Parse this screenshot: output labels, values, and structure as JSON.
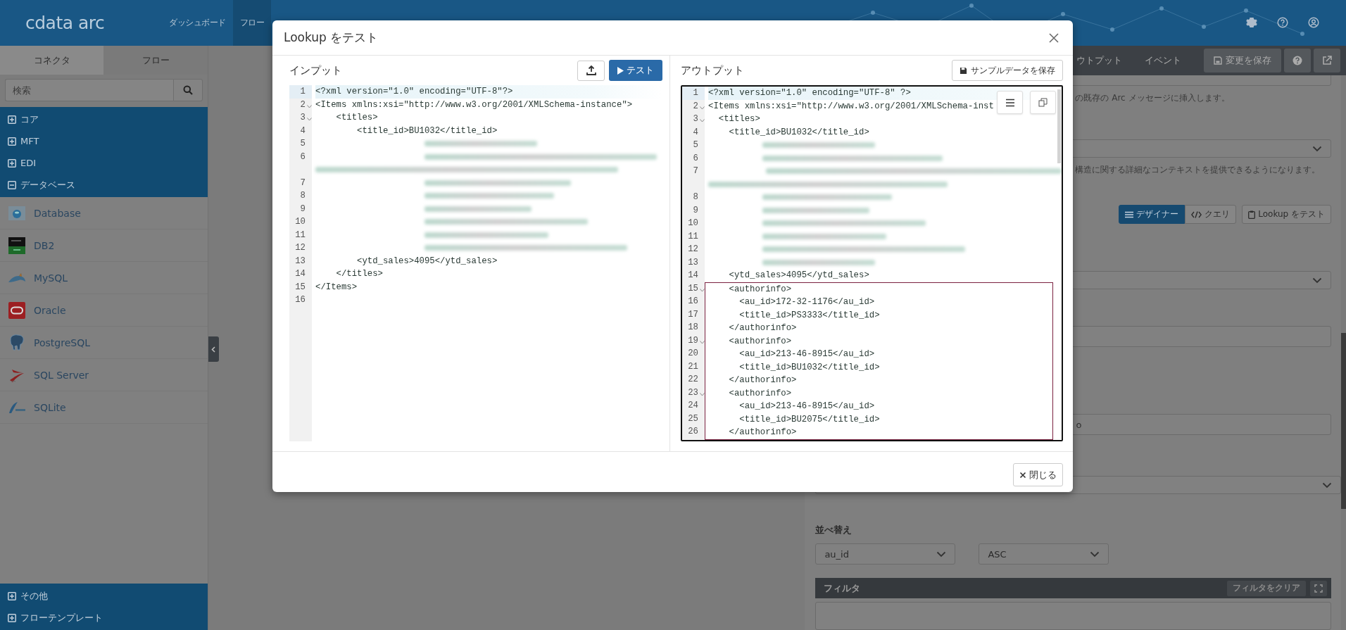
{
  "navbar": {
    "logo": "cdata arc",
    "items": [
      {
        "label": "ダッシュボード",
        "selected": false
      },
      {
        "label": "フロー",
        "selected": true
      }
    ]
  },
  "sidebar": {
    "tabs": [
      {
        "label": "コネクタ",
        "selected": true
      },
      {
        "label": "フロー",
        "selected": false
      }
    ],
    "search": {
      "placeholder": "検索"
    },
    "categories": [
      {
        "label": "コア",
        "expanded": false
      },
      {
        "label": "MFT",
        "expanded": false
      },
      {
        "label": "EDI",
        "expanded": false
      },
      {
        "label": "データベース",
        "expanded": true,
        "children": [
          {
            "label": "Database"
          },
          {
            "label": "DB2"
          },
          {
            "label": "MySQL"
          },
          {
            "label": "Oracle"
          },
          {
            "label": "PostgreSQL"
          },
          {
            "label": "SQL Server"
          },
          {
            "label": "SQLite"
          }
        ]
      }
    ],
    "bottom_categories": [
      {
        "label": "その他",
        "expanded": false
      },
      {
        "label": "フローテンプレート",
        "expanded": false
      }
    ]
  },
  "right_panel": {
    "tabs": [
      {
        "label": "ウトプット",
        "selected": false
      },
      {
        "label": "イベント",
        "selected": false
      }
    ],
    "save_button": "変更を保存",
    "hint_1": "の既存の Arc メッセージに挿入します。",
    "hint_2": "構造に関する詳細なコンテキストを提供できるようになります。",
    "mode_buttons": [
      {
        "label": "デザイナー",
        "selected": true
      },
      {
        "label": "クエリ",
        "selected": false
      }
    ],
    "test_lookup_button": "Lookup をテスト",
    "field_value": "o",
    "sort": {
      "label": "並べ替え",
      "column": "au_id",
      "order": "ASC"
    },
    "filter": {
      "title": "フィルタ",
      "clear_button": "フィルタをクリア"
    }
  },
  "modal": {
    "title": "Lookup をテスト",
    "input": {
      "title": "インプット",
      "test_button": "テスト",
      "lines": [
        {
          "n": "1",
          "kind": "code",
          "text": "<?xml version=\"1.0\" encoding=\"UTF-8\"?>",
          "foldable": false,
          "active": true
        },
        {
          "n": "2",
          "kind": "code",
          "text": "<Items xmlns:xsi=\"http://www.w3.org/2001/XMLSchema-instance\">",
          "foldable": true,
          "active": false
        },
        {
          "n": "3",
          "kind": "code",
          "text": "    <titles>",
          "foldable": true,
          "active": false
        },
        {
          "n": "4",
          "kind": "code",
          "text": "        <title_id>BU1032</title_id>",
          "foldable": false,
          "active": false
        },
        {
          "n": "5",
          "kind": "redacted",
          "foldable": false,
          "active": false
        },
        {
          "n": "6",
          "kind": "redacted_wrapped",
          "foldable": false,
          "active": false
        },
        {
          "n": "7",
          "kind": "redacted",
          "foldable": false,
          "active": false
        },
        {
          "n": "8",
          "kind": "redacted",
          "foldable": false,
          "active": false
        },
        {
          "n": "9",
          "kind": "redacted",
          "foldable": false,
          "active": false
        },
        {
          "n": "10",
          "kind": "redacted",
          "foldable": false,
          "active": false
        },
        {
          "n": "11",
          "kind": "redacted",
          "foldable": false,
          "active": false
        },
        {
          "n": "12",
          "kind": "redacted",
          "foldable": false,
          "active": false
        },
        {
          "n": "13",
          "kind": "code",
          "text": "        <ytd_sales>4095</ytd_sales>",
          "foldable": false,
          "active": false
        },
        {
          "n": "14",
          "kind": "code",
          "text": "    </titles>",
          "foldable": false,
          "active": false
        },
        {
          "n": "15",
          "kind": "code",
          "text": "</Items>",
          "foldable": false,
          "active": false
        },
        {
          "n": "16",
          "kind": "code",
          "foldable": false,
          "active": false
        }
      ]
    },
    "output": {
      "title": "アウトプット",
      "save_button": "サンプルデータを保存",
      "lines": [
        {
          "n": "1",
          "kind": "code",
          "text": "<?xml version=\"1.0\" encoding=\"UTF-8\" ?>",
          "foldable": false,
          "active": true,
          "boxed": false
        },
        {
          "n": "2",
          "kind": "code",
          "text": "<Items xmlns:xsi=\"http://www.w3.org/2001/XMLSchema-inst",
          "foldable": true,
          "active": false,
          "boxed": false
        },
        {
          "n": "3",
          "kind": "code",
          "text": "  <titles>",
          "foldable": true,
          "active": false,
          "boxed": false
        },
        {
          "n": "4",
          "kind": "code",
          "text": "    <title_id>BU1032</title_id>",
          "foldable": false,
          "active": false,
          "boxed": false
        },
        {
          "n": "5",
          "kind": "redacted",
          "foldable": false,
          "active": false,
          "boxed": false
        },
        {
          "n": "6",
          "kind": "redacted",
          "foldable": false,
          "active": false,
          "boxed": false
        },
        {
          "n": "7",
          "kind": "redacted_wrapped",
          "foldable": false,
          "active": false,
          "boxed": false
        },
        {
          "n": "8",
          "kind": "redacted",
          "foldable": false,
          "active": false,
          "boxed": false
        },
        {
          "n": "9",
          "kind": "redacted",
          "foldable": false,
          "active": false,
          "boxed": false
        },
        {
          "n": "10",
          "kind": "redacted",
          "foldable": false,
          "active": false,
          "boxed": false
        },
        {
          "n": "11",
          "kind": "redacted",
          "foldable": false,
          "active": false,
          "boxed": false
        },
        {
          "n": "12",
          "kind": "redacted",
          "foldable": false,
          "active": false,
          "boxed": false
        },
        {
          "n": "13",
          "kind": "redacted",
          "foldable": false,
          "active": false,
          "boxed": false
        },
        {
          "n": "14",
          "kind": "code",
          "text": "    <ytd_sales>4095</ytd_sales>",
          "foldable": false,
          "active": false,
          "boxed": false
        },
        {
          "n": "15",
          "kind": "code",
          "text": "    <authorinfo>",
          "foldable": true,
          "active": false,
          "boxed": true
        },
        {
          "n": "16",
          "kind": "code",
          "text": "      <au_id>172-32-1176</au_id>",
          "foldable": false,
          "active": false,
          "boxed": true
        },
        {
          "n": "17",
          "kind": "code",
          "text": "      <title_id>PS3333</title_id>",
          "foldable": false,
          "active": false,
          "boxed": true
        },
        {
          "n": "18",
          "kind": "code",
          "text": "    </authorinfo>",
          "foldable": false,
          "active": false,
          "boxed": true
        },
        {
          "n": "19",
          "kind": "code",
          "text": "    <authorinfo>",
          "foldable": true,
          "active": false,
          "boxed": true
        },
        {
          "n": "20",
          "kind": "code",
          "text": "      <au_id>213-46-8915</au_id>",
          "foldable": false,
          "active": false,
          "boxed": true
        },
        {
          "n": "21",
          "kind": "code",
          "text": "      <title_id>BU1032</title_id>",
          "foldable": false,
          "active": false,
          "boxed": true
        },
        {
          "n": "22",
          "kind": "code",
          "text": "    </authorinfo>",
          "foldable": false,
          "active": false,
          "boxed": true
        },
        {
          "n": "23",
          "kind": "code",
          "text": "    <authorinfo>",
          "foldable": true,
          "active": false,
          "boxed": true
        },
        {
          "n": "24",
          "kind": "code",
          "text": "      <au_id>213-46-8915</au_id>",
          "foldable": false,
          "active": false,
          "boxed": true
        },
        {
          "n": "25",
          "kind": "code",
          "text": "      <title_id>BU2075</title_id>",
          "foldable": false,
          "active": false,
          "boxed": true
        },
        {
          "n": "26",
          "kind": "code",
          "text": "    </authorinfo>",
          "foldable": false,
          "active": false,
          "boxed": true
        }
      ]
    },
    "close_button": "閉じる"
  }
}
